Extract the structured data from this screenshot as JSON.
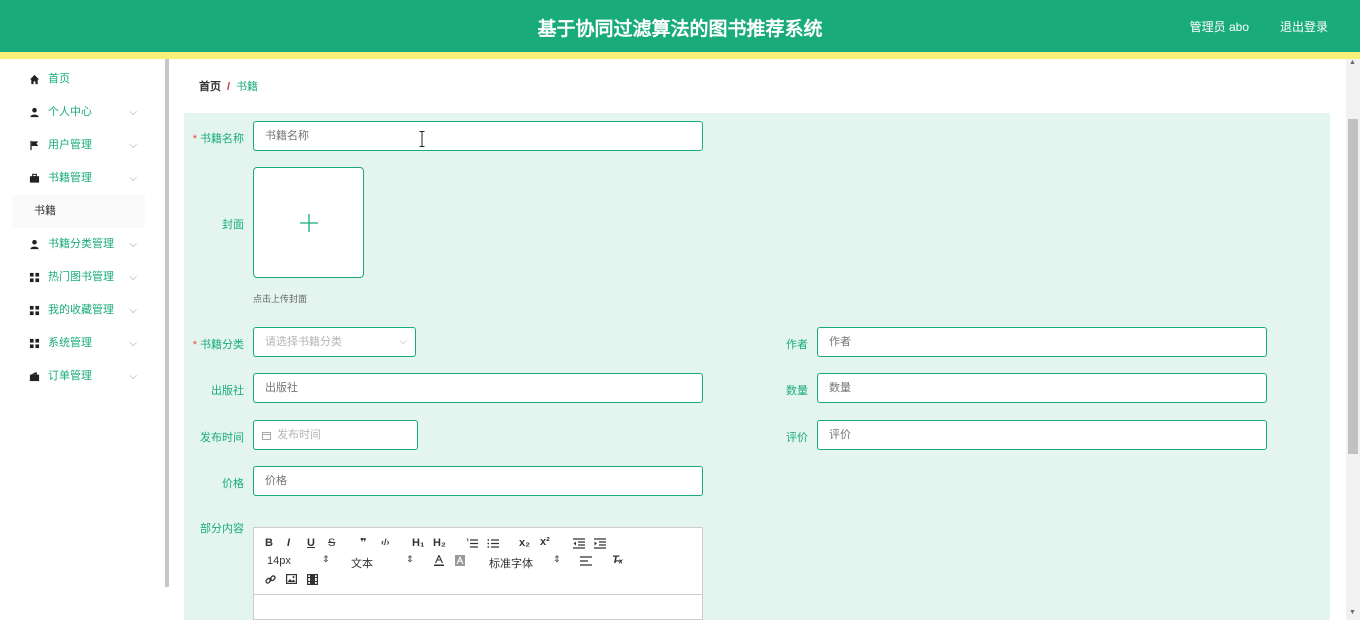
{
  "header": {
    "title": "基于协同过滤算法的图书推荐系统",
    "user": "管理员 abo",
    "logout": "退出登录",
    "color": "#1aab7b",
    "stripe_color": "#f6f279"
  },
  "sidebar": {
    "items": [
      {
        "label": "首页",
        "icon": "home-icon"
      },
      {
        "label": "个人中心",
        "icon": "user-icon"
      },
      {
        "label": "用户管理",
        "icon": "flag-icon"
      },
      {
        "label": "书籍管理",
        "icon": "briefcase-icon"
      },
      {
        "label": "书籍",
        "icon": ""
      },
      {
        "label": "书籍分类管理",
        "icon": "user-icon"
      },
      {
        "label": "热门图书管理",
        "icon": "grid-icon"
      },
      {
        "label": "我的收藏管理",
        "icon": "grid-icon"
      },
      {
        "label": "系统管理",
        "icon": "grid-icon"
      },
      {
        "label": "订单管理",
        "icon": "wallet-icon"
      }
    ]
  },
  "breadcrumb": {
    "home": "首页",
    "separator": "/",
    "current": "书籍"
  },
  "form": {
    "book_name": {
      "label": "书籍名称",
      "placeholder": "书籍名称"
    },
    "cover": {
      "label": "封面",
      "hint": "点击上传封面"
    },
    "category": {
      "label": "书籍分类",
      "placeholder": "请选择书籍分类"
    },
    "author": {
      "label": "作者",
      "placeholder": "作者"
    },
    "publisher": {
      "label": "出版社",
      "placeholder": "出版社"
    },
    "quantity": {
      "label": "数量",
      "placeholder": "数量"
    },
    "publish_date": {
      "label": "发布时间",
      "placeholder": "发布时间"
    },
    "rating": {
      "label": "评价",
      "placeholder": "评价"
    },
    "price": {
      "label": "价格",
      "placeholder": "价格"
    },
    "content": {
      "label": "部分内容"
    }
  },
  "editor": {
    "bold": "B",
    "italic": "I",
    "underline": "U",
    "strike": "S",
    "quote": "❞",
    "code": "‹/›",
    "h1": "H₁",
    "h2": "H₂",
    "sub": "x₂",
    "sup": "x²",
    "size": "14px",
    "text": "文本",
    "font": "标准字体",
    "clean": "T̶ₓ"
  }
}
